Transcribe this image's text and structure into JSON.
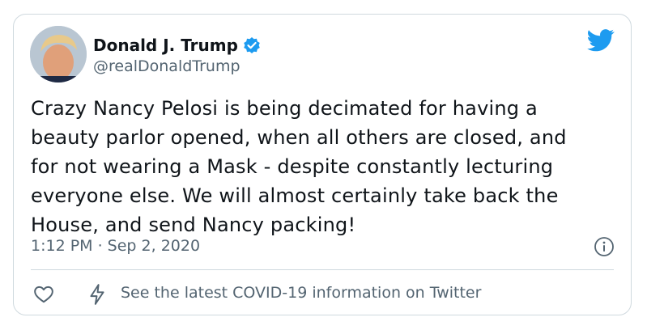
{
  "tweet": {
    "author": {
      "display_name": "Donald J. Trump",
      "handle": "@realDonaldTrump",
      "verified": true,
      "avatar_icon": "profile-photo"
    },
    "lines": [
      "Crazy Nancy Pelosi is being decimated for having a",
      "beauty parlor opened, when all others are closed, and",
      "for not wearing a Mask - despite constantly lecturing",
      "everyone else. We will almost certainly take back the",
      "House, and send Nancy packing!"
    ],
    "timestamp": "1:12 PM · Sep 2, 2020",
    "covid_notice": "See the latest COVID-19 information on Twitter"
  },
  "icons": {
    "brand": "twitter-bird-icon",
    "verified": "verified-badge-icon",
    "info": "info-icon",
    "like": "heart-icon",
    "notice": "lightning-bolt-icon"
  },
  "colors": {
    "brand_blue": "#1d9bf0",
    "text_primary": "#0f1419",
    "text_secondary": "#536471",
    "border": "#cfd9de"
  }
}
